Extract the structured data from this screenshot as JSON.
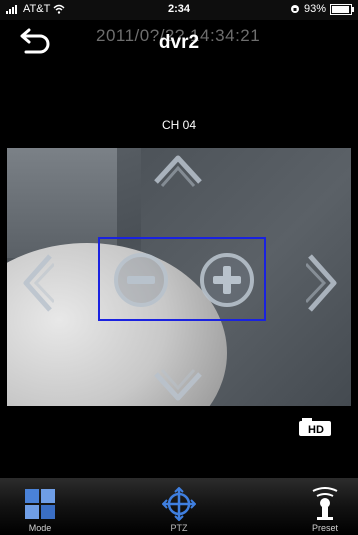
{
  "status_bar": {
    "carrier": "AT&T",
    "time": "2:34",
    "battery": "93%",
    "battery_level": 0.93
  },
  "nav": {
    "title": "dvr2",
    "timestamp": "2011/0?/2? 14:34:21"
  },
  "channel": {
    "label": "CH 04"
  },
  "video": {
    "hd_badge": "HD"
  },
  "tabs": [
    {
      "label": "Mode",
      "icon": "grid-icon"
    },
    {
      "label": "PTZ",
      "icon": "ptz-crosshair-icon"
    },
    {
      "label": "Preset",
      "icon": "preset-camera-icon"
    }
  ],
  "colors": {
    "zoom_box_border": "#1a22e0",
    "ptz_accent": "#2f6fd8",
    "mode_tiles": "#3f7fe0"
  }
}
